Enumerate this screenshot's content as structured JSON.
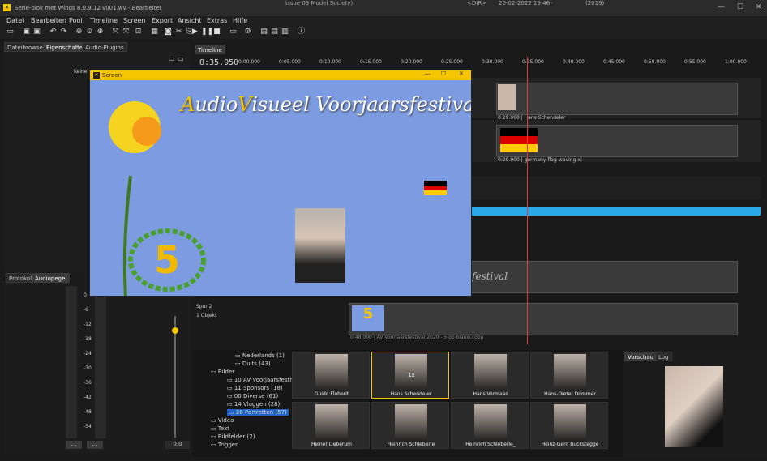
{
  "window": {
    "title": "Serie-blok met Wings 8.0.9.12 v001.wv - Bearbeitet",
    "bg_issue": "Issue 09 Model Society)",
    "bg_dir": "<DIR>",
    "bg_date": "20-02-2022 19:46",
    "bg_dash": "----",
    "bg_year": "(2019)"
  },
  "menu": [
    "Datei",
    "Bearbeiten",
    "Pool",
    "Timeline",
    "Screen",
    "Export",
    "Ansicht",
    "Extras",
    "Hilfe"
  ],
  "left_tabs": [
    "Dateibrowser",
    "Eigenschaften",
    "Audio-Plugins"
  ],
  "left_panel_text": "Keine",
  "audio_tabs": [
    "Protokoll",
    "Audiopegel"
  ],
  "audio_scale": [
    "0",
    "-6",
    "-12",
    "-18",
    "-24",
    "-30",
    "-36",
    "-42",
    "-48",
    "-54"
  ],
  "audio_buttons": [
    "...",
    "..."
  ],
  "audio_value": "0.0",
  "audio_level": 0.88,
  "timeline": {
    "tab": "Timeline",
    "timecode": "0:35.950",
    "ruler": [
      "0:00.000",
      "0:05.000",
      "0:10.000",
      "0:15.000",
      "0:20.000",
      "0:25.000",
      "0:30.000",
      "0:35.000",
      "0:40.000",
      "0:45.000",
      "0:50.000",
      "0:55.000",
      "1:00.000"
    ],
    "clips": [
      {
        "label": "0:29.900 | Hans Schendeler"
      },
      {
        "label": "0:29.900 | germany-flag-waving-xl"
      },
      {
        "label": "festival"
      },
      {
        "label": "0:48.000 | AV Voorjaarsfestival 2020 - 5 op blauw.copp"
      }
    ],
    "track2_name": "Spur 2",
    "track2_sub": "1 Objekt"
  },
  "screen": {
    "title": "Screen",
    "banner_a": "A",
    "banner_udio": "udio",
    "banner_v": "V",
    "banner_rest": "isueel Voorjaarsfestival",
    "badge_number": "5"
  },
  "pool_tree": [
    "Nederlands (1)",
    "Duits (43)",
    "Bilder",
    "10 AV Voorjaarsfestival (60)",
    "11 Sponsors (18)",
    "00 Diverse (61)",
    "14 Vlaggen (28)",
    "20 Portretten (57)",
    "Video",
    "Text",
    "Bildfelder (2)",
    "Trigger"
  ],
  "thumbs": [
    {
      "caption": "Guido Floberit"
    },
    {
      "caption": "Hans Schendeler",
      "badge": "1x"
    },
    {
      "caption": "Hans Vermaas"
    },
    {
      "caption": "Hans-Dieter Dommer"
    },
    {
      "caption": "Heiner Lieberum"
    },
    {
      "caption": "Heinrich Schleberle"
    },
    {
      "caption": "Heinrich Schleberle_"
    },
    {
      "caption": "Heinz-Gerd Buckstegge"
    }
  ],
  "preview_tabs": [
    "Vorschau",
    "Log"
  ],
  "colors": {
    "accent": "#f7c500",
    "timeline_blue": "#29a9e6",
    "playhead": "#e53935",
    "selected": "#1e63c6"
  }
}
